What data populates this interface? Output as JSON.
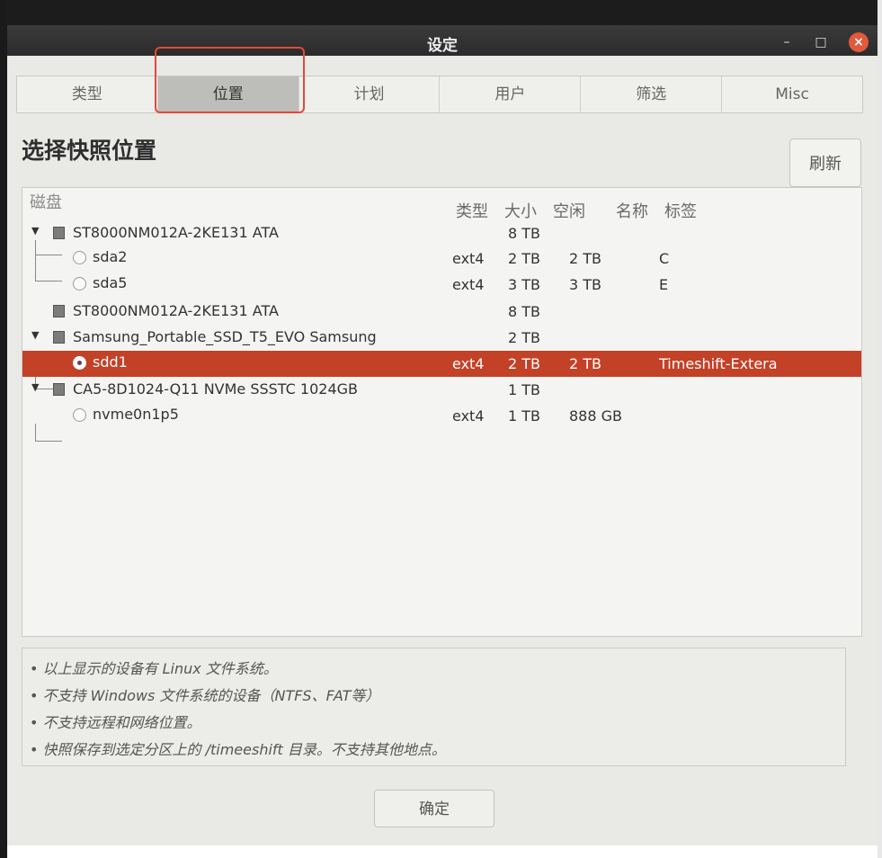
{
  "window": {
    "title": "设定",
    "minimize_glyph": "–",
    "maximize_glyph": "□",
    "close_glyph": "×"
  },
  "tabs": [
    {
      "label": "类型",
      "active": false
    },
    {
      "label": "位置",
      "active": true
    },
    {
      "label": "计划",
      "active": false
    },
    {
      "label": "用户",
      "active": false
    },
    {
      "label": "筛选",
      "active": false
    },
    {
      "label": "Misc",
      "active": false
    }
  ],
  "section": {
    "title": "选择快照位置",
    "refresh_label": "刷新"
  },
  "disk_table": {
    "headers": {
      "disk": "磁盘",
      "type": "类型",
      "size": "大小",
      "free": "空闲",
      "name": "名称",
      "label": "标签"
    },
    "disks": [
      {
        "name": "ST8000NM012A-2KE131 ATA",
        "size": "8 TB",
        "expanded": true,
        "partitions": [
          {
            "name": "sda2",
            "type": "ext4",
            "size": "2 TB",
            "free": "2 TB",
            "label": "C",
            "selected": false
          },
          {
            "name": "sda5",
            "type": "ext4",
            "size": "3 TB",
            "free": "3 TB",
            "label": "E",
            "selected": false
          }
        ]
      },
      {
        "name": "ST8000NM012A-2KE131 ATA",
        "size": "8 TB",
        "expanded": false,
        "partitions": []
      },
      {
        "name": "Samsung_Portable_SSD_T5_EVO Samsung",
        "size": "2 TB",
        "expanded": true,
        "partitions": [
          {
            "name": "sdd1",
            "type": "ext4",
            "size": "2 TB",
            "free": "2 TB",
            "label": "Timeshift-Extera",
            "selected": true
          }
        ]
      },
      {
        "name": "CA5-8D1024-Q11 NVMe SSSTC 1024GB",
        "size": "1 TB",
        "expanded": true,
        "partitions": [
          {
            "name": "nvme0n1p5",
            "type": "ext4",
            "size": "1 TB",
            "free": "888 GB",
            "label": "",
            "selected": false
          }
        ]
      }
    ]
  },
  "info_lines": [
    "• 以上显示的设备有 Linux 文件系统。",
    "• 不支持 Windows 文件系统的设备（NTFS、FAT等）",
    "• 不支持远程和网络位置。",
    "• 快照保存到选定分区上的 /timeeshift 目录。不支持其他地点。"
  ],
  "footer": {
    "ok_label": "确定"
  },
  "colors": {
    "selected_row": "#c34127",
    "titlebar": "#2b2b2b",
    "close_button": "#e15a3b",
    "annotation": "#e3483c"
  }
}
